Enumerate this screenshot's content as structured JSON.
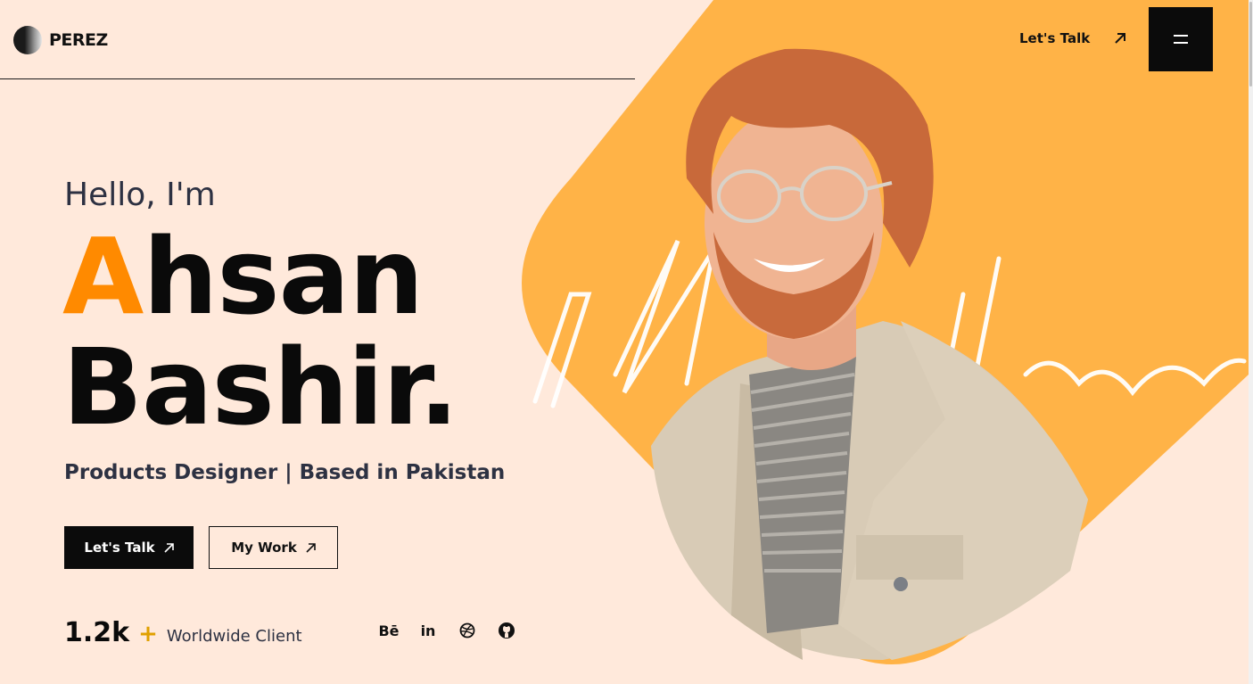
{
  "header": {
    "logo_text": "PEREZ",
    "talk_label": "Let's Talk",
    "menu_icon": "hamburger-icon"
  },
  "hero": {
    "greeting": "Hello, I'm",
    "name_first_letter": "A",
    "name_first_rest": "hsan",
    "name_last": "Bashir.",
    "role": "Products Designer | Based in Pakistan",
    "primary_button": "Let's Talk",
    "secondary_button": "My Work",
    "stats_number": "1.2k",
    "stats_plus": "+",
    "stats_label": "Worldwide Client"
  },
  "socials": [
    {
      "label": "Bē",
      "icon": "behance-icon"
    },
    {
      "label": "in",
      "icon": "linkedin-icon"
    },
    {
      "label": "",
      "icon": "dribbble-icon"
    },
    {
      "label": "",
      "icon": "github-icon"
    }
  ],
  "colors": {
    "background": "#ffe9db",
    "accent_orange": "#ff8a00",
    "shape_yellow": "#ffb347",
    "dark": "#0b0b0b"
  }
}
